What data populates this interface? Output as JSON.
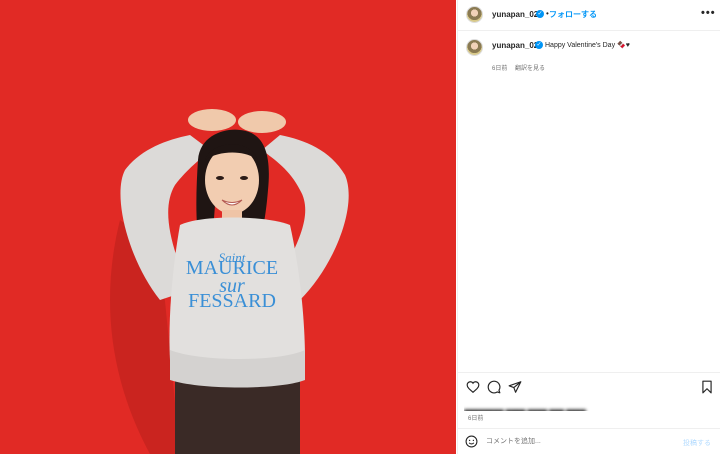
{
  "post": {
    "username": "yunapan_02",
    "verified_icon": "verified-badge-icon",
    "follow_label": "フォローする",
    "separator": "•",
    "more_label": "•••",
    "caption": "Happy Valentine's Day 🍫♥",
    "caption_time": "6日前",
    "translate_label": "翻訳を見る",
    "post_time": "6日前",
    "likes_blurred": "████████ ████ ████ ███ ████"
  },
  "photo": {
    "background_color": "#e12a25",
    "sweatshirt_text": [
      "Saint",
      "MAURICE",
      "sur",
      "FESSARD"
    ],
    "text_color": "#3a8fd6"
  },
  "actions": {
    "icons": [
      "heart-icon",
      "comment-icon",
      "share-icon",
      "bookmark-icon"
    ]
  },
  "comment": {
    "placeholder": "コメントを追加...",
    "post_label": "投稿する"
  }
}
